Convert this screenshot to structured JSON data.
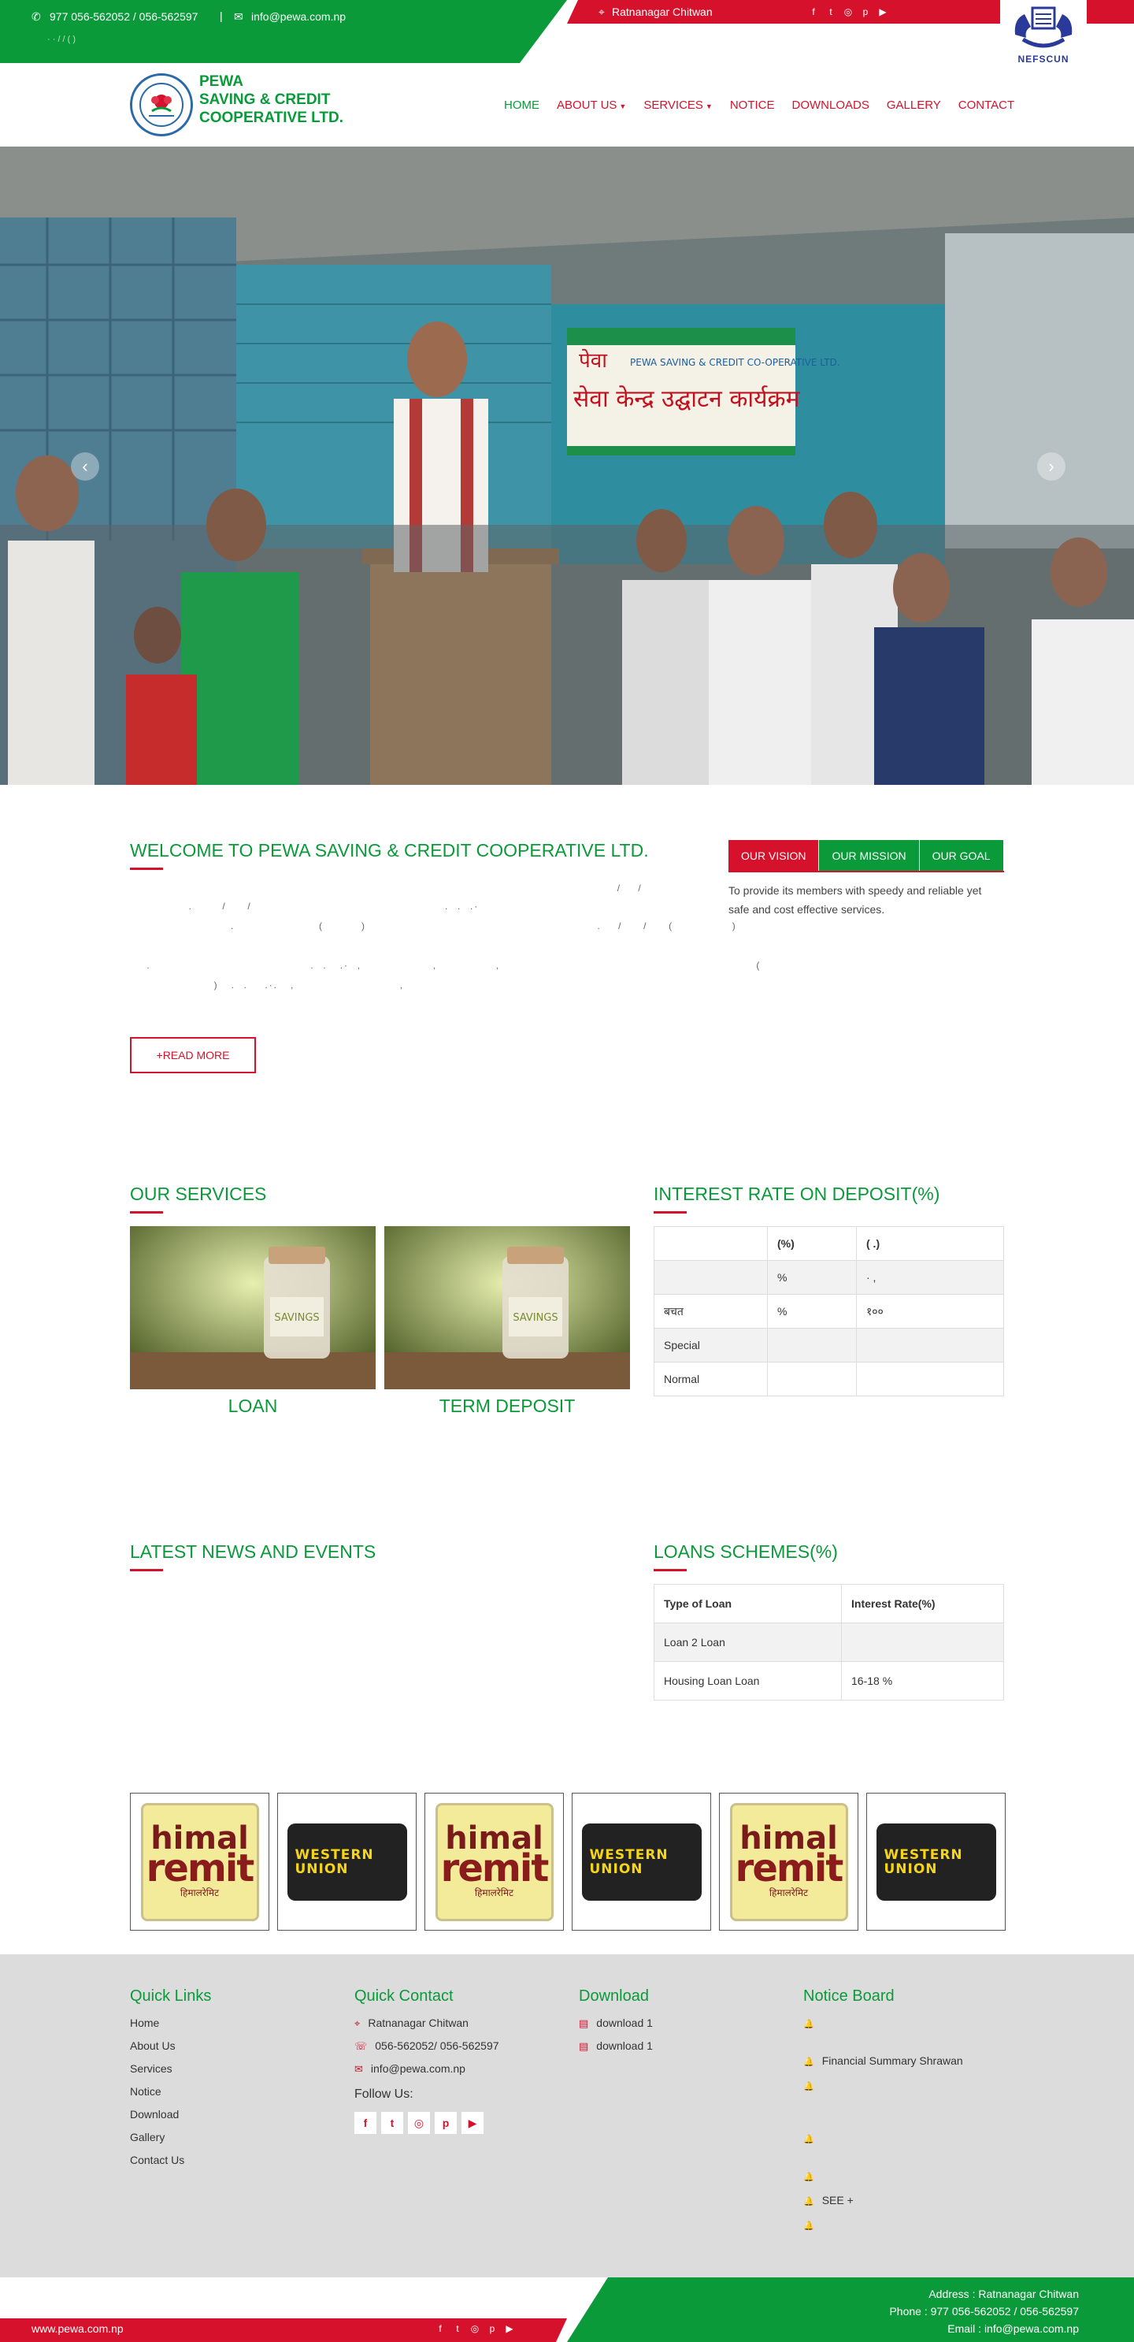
{
  "topbar": {
    "phone": "977 056-562052 /  056-562597",
    "separator": "|",
    "email": "info@pewa.com.np",
    "sub_line": "·   ·             /       /        (              )",
    "address": "Ratnanagar Chitwan",
    "social_icons": [
      "facebook-icon",
      "twitter-icon",
      "instagram-icon",
      "pinterest-icon",
      "youtube-icon"
    ],
    "social_glyphs": [
      "f",
      "t",
      "◎",
      "p",
      "▶"
    ],
    "partner_logo_label": "NEFSCUN"
  },
  "header": {
    "brand_line1": "PEWA",
    "brand_line2": "SAVING & CREDIT",
    "brand_line3": "COOPERATIVE LTD.",
    "nav": [
      {
        "label": "HOME",
        "active": true
      },
      {
        "label": "ABOUT US",
        "dropdown": true
      },
      {
        "label": "SERVICES",
        "dropdown": true
      },
      {
        "label": "NOTICE"
      },
      {
        "label": "DOWNLOADS"
      },
      {
        "label": "GALLERY"
      },
      {
        "label": "CONTACT"
      }
    ]
  },
  "hero": {
    "banner_title": "सेवा केन्द्र उद्घाटन कार्यक्रम",
    "banner_org": "PEWA SAVING & CREDIT CO-OPERATIVE LTD.",
    "banner_brand": "पेवा",
    "prev_glyph": "‹",
    "next_glyph": "›"
  },
  "welcome": {
    "title": "WELCOME TO PEWA SAVING & CREDIT COOPERATIVE LTD.",
    "para1_line1": "                                                                                                                    /    /",
    "para1_line2": "              .       /     /                                              .  .  .·",
    "para1_line3": "                        .                    (         )                                                       .    /     /     (              )",
    "para2_line1": "    .                                      .  .   .·  ,                 ,              ,                                                             (",
    "para2_line2": "                    )   .  .    .·.   ,                         ,",
    "read_more": "+READ MORE",
    "tabs": [
      "OUR VISION",
      "OUR MISSION",
      "OUR GOAL"
    ],
    "vision_text": "To provide its members with speedy and reliable yet safe and cost effective services."
  },
  "services": {
    "title": "OUR SERVICES",
    "items": [
      {
        "label": "LOAN",
        "jar_text": "SAVINGS"
      },
      {
        "label": "TERM DEPOSIT",
        "jar_text": "SAVINGS"
      }
    ]
  },
  "interest": {
    "title": "INTEREST RATE ON DEPOSIT(%)",
    "rows": [
      [
        "",
        "(%)",
        "(    .)"
      ],
      [
        "",
        "%",
        "    ·  ,"
      ],
      [
        "बचत",
        "%",
        "१००"
      ],
      [
        "Special",
        "",
        ""
      ],
      [
        "Normal",
        "",
        ""
      ]
    ]
  },
  "news": {
    "title": "LATEST NEWS AND EVENTS"
  },
  "loans": {
    "title": "LOANS SCHEMES(%)",
    "headers": [
      "Type of Loan",
      "Interest Rate(%)"
    ],
    "rows": [
      [
        "Loan 2 Loan",
        ""
      ],
      [
        "Housing Loan Loan",
        "16-18 %"
      ]
    ]
  },
  "partners": {
    "himal": {
      "line1": "himal",
      "line2": "remit",
      "line3": "हिमालरेमिट"
    },
    "western_union": {
      "line1": "WESTERN",
      "line2": "UNION"
    }
  },
  "footer": {
    "quick_links_title": "Quick Links",
    "quick_links": [
      "Home",
      "About Us",
      "Services",
      "Notice",
      "Download",
      "Gallery",
      "Contact Us"
    ],
    "contact_title": "Quick Contact",
    "contact_address": "Ratnanagar Chitwan",
    "contact_phone": "056-562052/ 056-562597",
    "contact_email": "info@pewa.com.np",
    "follow_label": "Follow Us:",
    "follow_icons": [
      "facebook-icon",
      "twitter-icon",
      "instagram-icon",
      "pinterest-icon",
      "youtube-icon"
    ],
    "follow_glyphs": [
      "f",
      "t",
      "◎",
      "p",
      "▶"
    ],
    "download_title": "Download",
    "downloads": [
      "download 1",
      "download 1"
    ],
    "notice_title": "Notice Board",
    "notices": [
      "",
      "Financial Summary Shrawan",
      "",
      "",
      "",
      "SEE     +",
      ""
    ]
  },
  "bottombar": {
    "site": "www.pewa.com.np",
    "address": "Address : Ratnanagar Chitwan",
    "phone": "Phone : 977 056-562052 /  056-562597",
    "email": "Email : info@pewa.com.np"
  },
  "colors": {
    "green": "#0a9a3a",
    "red": "#d6112b",
    "footer_bg": "#dcdcdc"
  }
}
